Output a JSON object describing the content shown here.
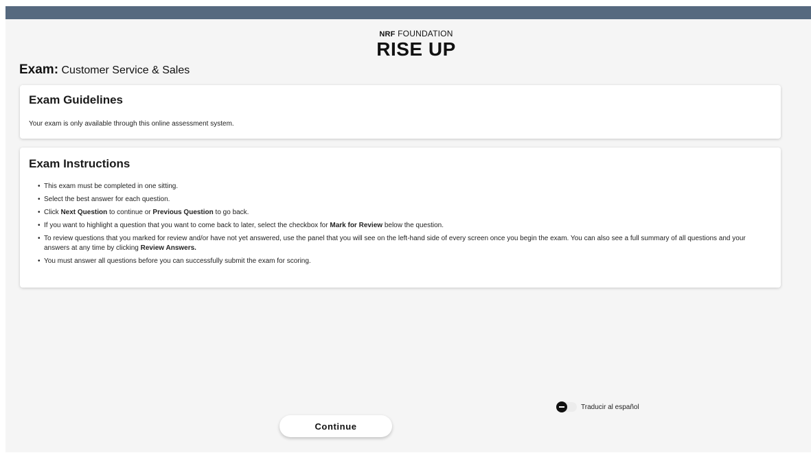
{
  "brand": {
    "org_bold": "NRF",
    "org_rest": " FOUNDATION",
    "program": "RISE UP"
  },
  "exam": {
    "label": "Exam:",
    "name": "Customer Service & Sales"
  },
  "guidelines": {
    "heading": "Exam Guidelines",
    "text": "Your exam is only available through this online assessment system."
  },
  "instructions": {
    "heading": "Exam Instructions",
    "items": [
      {
        "text": "This exam must be completed in one sitting."
      },
      {
        "text": "Select the best answer for each question."
      },
      {
        "pre": "Click ",
        "b1": "Next Question",
        "mid": " to continue or ",
        "b2": "Previous Question",
        "post": " to go back."
      },
      {
        "pre": "If you want to highlight a question that you want to come back to later, select the checkbox for ",
        "b1": "Mark for Review",
        "post": " below the question."
      },
      {
        "pre": "To review questions that you marked for review and/or have not yet answered, use the panel that you will see on the left-hand side of every screen once you begin the exam. You can also see a full summary of all questions and your answers at any time by clicking ",
        "b1": "Review Answers."
      },
      {
        "text": "You must answer all questions before you can successfully submit the exam for scoring."
      }
    ]
  },
  "translate_toggle": {
    "label": "Traducir al español",
    "enabled": false
  },
  "continue_label": "Continue",
  "colors": {
    "top_bar": "#56697f",
    "background": "#f5f5f5",
    "card": "#ffffff"
  }
}
